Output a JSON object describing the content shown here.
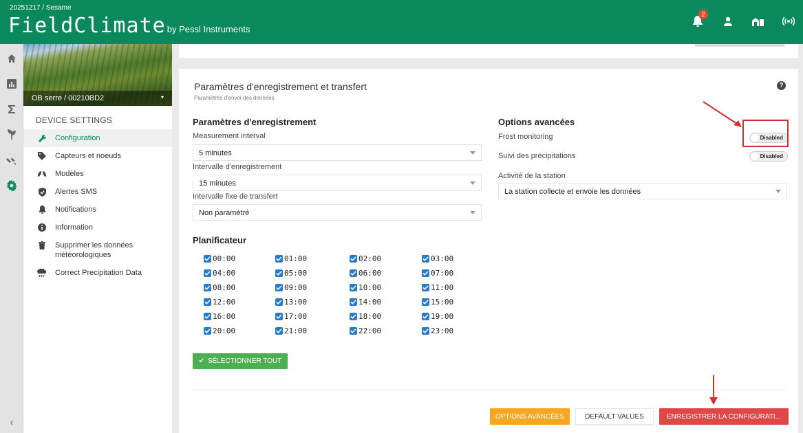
{
  "header": {
    "breadcrumb": "20251217 / Sesame",
    "brand": "FieldClimate",
    "brand_sub": "by Pessl Instruments",
    "notification_count": "2",
    "color": "#0a8a5c"
  },
  "sidebar": {
    "device": "OB serre / 00210BD2",
    "section_title": "DEVICE SETTINGS",
    "items": [
      {
        "label": "Configuration",
        "icon": "wrench-icon",
        "active": true
      },
      {
        "label": "Capteurs et noeuds",
        "icon": "tag-icon"
      },
      {
        "label": "Modèles",
        "icon": "leaves-icon"
      },
      {
        "label": "Alertes SMS",
        "icon": "shield-icon"
      },
      {
        "label": "Notifications",
        "icon": "bell-icon"
      },
      {
        "label": "Information",
        "icon": "info-icon"
      },
      {
        "label": "Supprimer les données météorologiques",
        "icon": "trash-icon"
      },
      {
        "label": "Correct Precipitation Data",
        "icon": "rain-cloud-icon"
      }
    ]
  },
  "card": {
    "title": "Paramètres d'enregistrement et transfert",
    "subtitle": "Paramètres d'envoi des données",
    "recording": {
      "title": "Paramètres d'enregistrement",
      "measurement_label": "Measurement interval",
      "measurement_value": "5 minutes",
      "logging_label": "Intervalle d'enregistrement",
      "logging_value": "15 minutes",
      "transfer_label": "Intervalle fixe de transfert",
      "transfer_value": "Non paramétré"
    },
    "advanced": {
      "title": "Options avancées",
      "frost_label": "Frost monitoring",
      "frost_state": "Disabled",
      "precip_label": "Suivi des précipitations",
      "precip_state": "Disabled",
      "activity_label": "Activité de la station",
      "activity_value": "La station collecte et envoie les données"
    },
    "scheduler": {
      "title": "Planificateur",
      "hours": [
        "00:00",
        "01:00",
        "02:00",
        "03:00",
        "04:00",
        "05:00",
        "06:00",
        "07:00",
        "08:00",
        "09:00",
        "10:00",
        "11:00",
        "12:00",
        "13:00",
        "14:00",
        "15:00",
        "16:00",
        "17:00",
        "18:00",
        "19:00",
        "20:00",
        "21:00",
        "22:00",
        "23:00"
      ]
    },
    "select_all": "SÉLECTIONNER TOUT",
    "buttons": {
      "advanced": "OPTIONS AVANCÉES",
      "defaults": "DEFAULT VALUES",
      "save": "ENREGISTRER LA CONFIGURATI..."
    }
  },
  "colors": {
    "annotation": "#d32f2f",
    "checkbox": "#2a7ccb",
    "green_button": "#4caf50",
    "orange_button": "#f5a623",
    "red_button": "#e04848"
  }
}
